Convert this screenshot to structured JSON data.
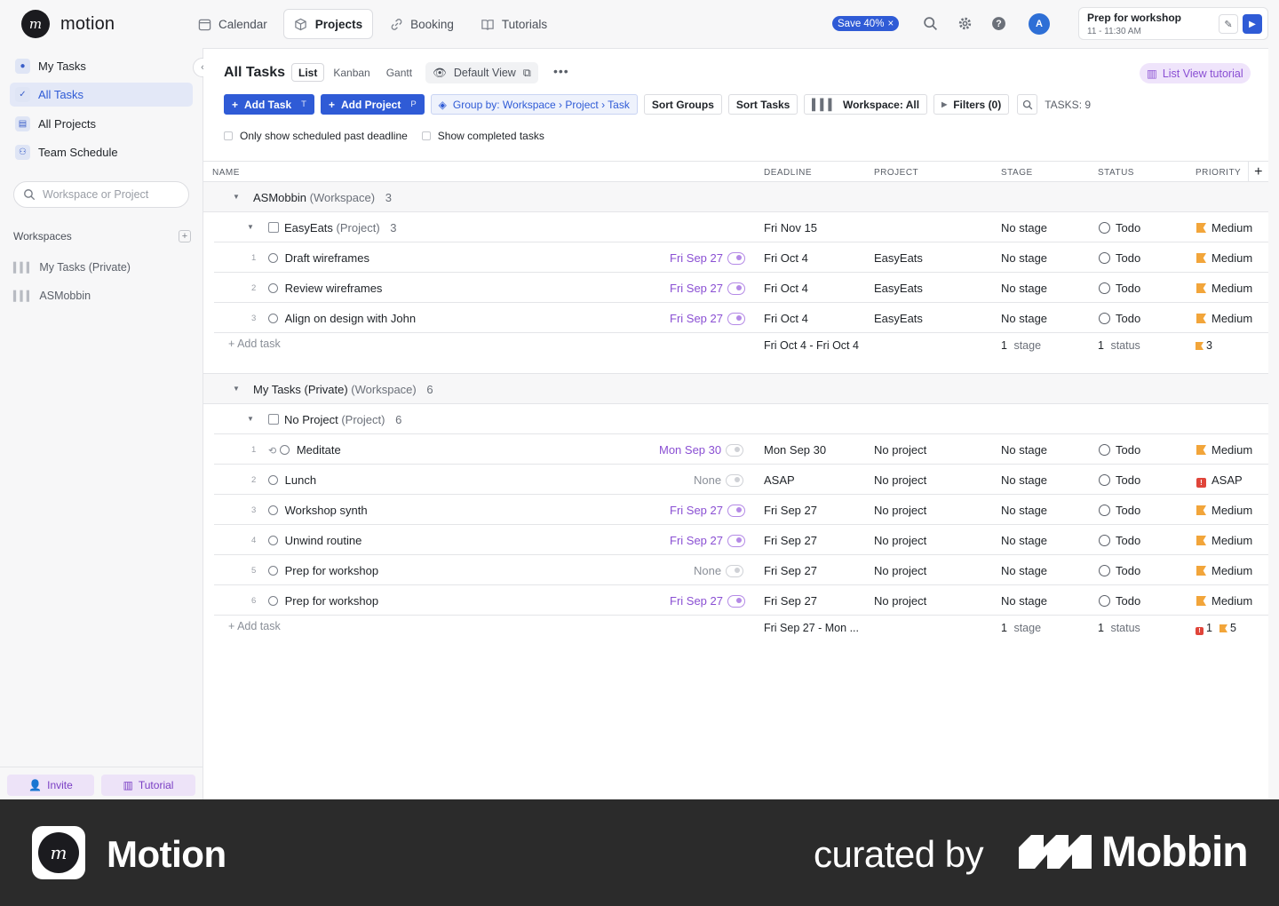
{
  "app": {
    "name": "motion"
  },
  "topnav": [
    {
      "label": "Calendar",
      "icon": "calendar-icon",
      "active": false
    },
    {
      "label": "Projects",
      "icon": "cube-icon",
      "active": true
    },
    {
      "label": "Booking",
      "icon": "link-icon",
      "active": false
    },
    {
      "label": "Tutorials",
      "icon": "book-icon",
      "active": false
    }
  ],
  "promo": {
    "label": "Save 40%",
    "close": "×"
  },
  "avatar": {
    "initial": "A"
  },
  "event": {
    "title": "Prep for workshop",
    "time": "11 - 11:30 AM"
  },
  "sidebar": {
    "items": [
      {
        "label": "My Tasks",
        "icon": "person-icon"
      },
      {
        "label": "All Tasks",
        "icon": "checkbox-icon"
      },
      {
        "label": "All Projects",
        "icon": "folder-icon"
      },
      {
        "label": "Team Schedule",
        "icon": "team-icon"
      }
    ],
    "search_placeholder": "Workspace or Project",
    "workspaces_label": "Workspaces",
    "workspaces": [
      {
        "label": "My Tasks (Private)"
      },
      {
        "label": "ASMobbin"
      }
    ],
    "invite_label": "Invite",
    "tutorial_label": "Tutorial"
  },
  "main": {
    "title": "All Tasks",
    "view_tabs": [
      "List",
      "Kanban",
      "Gantt"
    ],
    "default_view": "Default View",
    "tutorial_pill": "List View tutorial",
    "toolbar": {
      "add_task": "Add Task",
      "add_task_kbd": "T",
      "add_project": "Add Project",
      "add_project_kbd": "P",
      "group_by": "Group by: Workspace › Project › Task",
      "sort_groups": "Sort Groups",
      "sort_tasks": "Sort Tasks",
      "workspace": "Workspace: All",
      "filters": "Filters (0)",
      "tasks_count": "TASKS: 9"
    },
    "filters": {
      "past_deadline": "Only show scheduled past deadline",
      "show_completed": "Show completed tasks"
    },
    "columns": [
      "NAME",
      "DEADLINE",
      "PROJECT",
      "STAGE",
      "STATUS",
      "PRIORITY"
    ],
    "groups": [
      {
        "workspace": "ASMobbin",
        "workspace_suffix": "(Workspace)",
        "workspace_count": "3",
        "project": "EasyEats",
        "project_suffix": "(Project)",
        "project_count": "3",
        "project_deadline": "Fri Nov 15",
        "project_stage": "No stage",
        "project_status": "Todo",
        "project_priority": "Medium",
        "tasks": [
          {
            "idx": "1",
            "name": "Draft wireframes",
            "scheduled": "Fri Sep 27",
            "deadline": "Fri Oct 4",
            "project": "EasyEats",
            "stage": "No stage",
            "status": "Todo",
            "priority": "Medium"
          },
          {
            "idx": "2",
            "name": "Review wireframes",
            "scheduled": "Fri Sep 27",
            "deadline": "Fri Oct 4",
            "project": "EasyEats",
            "stage": "No stage",
            "status": "Todo",
            "priority": "Medium"
          },
          {
            "idx": "3",
            "name": "Align on design with John",
            "scheduled": "Fri Sep 27",
            "deadline": "Fri Oct 4",
            "project": "EasyEats",
            "stage": "No stage",
            "status": "Todo",
            "priority": "Medium"
          }
        ],
        "summary": {
          "add_task": "Add task",
          "deadline_range": "Fri Oct 4 - Fri Oct 4",
          "stage_count": "1",
          "stage_label": "stage",
          "status_count": "1",
          "status_label": "status",
          "priority_count": "3"
        }
      },
      {
        "workspace": "My Tasks (Private)",
        "workspace_suffix": "(Workspace)",
        "workspace_count": "6",
        "project": "No Project",
        "project_suffix": "(Project)",
        "project_count": "6",
        "tasks": [
          {
            "idx": "1",
            "name": "Meditate",
            "scheduled": "Mon Sep 30",
            "deadline": "Mon Sep 30",
            "project": "No project",
            "stage": "No stage",
            "status": "Todo",
            "priority": "Medium"
          },
          {
            "idx": "2",
            "name": "Lunch",
            "scheduled": "None",
            "deadline": "ASAP",
            "project": "No project",
            "stage": "No stage",
            "status": "Todo",
            "priority": "ASAP"
          },
          {
            "idx": "3",
            "name": "Workshop synth",
            "scheduled": "Fri Sep 27",
            "deadline": "Fri Sep 27",
            "project": "No project",
            "stage": "No stage",
            "status": "Todo",
            "priority": "Medium"
          },
          {
            "idx": "4",
            "name": "Unwind routine",
            "scheduled": "Fri Sep 27",
            "deadline": "Fri Sep 27",
            "project": "No project",
            "stage": "No stage",
            "status": "Todo",
            "priority": "Medium"
          },
          {
            "idx": "5",
            "name": "Prep for workshop",
            "scheduled": "None",
            "deadline": "Fri Sep 27",
            "project": "No project",
            "stage": "No stage",
            "status": "Todo",
            "priority": "Medium"
          },
          {
            "idx": "6",
            "name": "Prep for workshop",
            "scheduled": "Fri Sep 27",
            "deadline": "Fri Sep 27",
            "project": "No project",
            "stage": "No stage",
            "status": "Todo",
            "priority": "Medium"
          }
        ],
        "summary": {
          "add_task": "Add task",
          "deadline_range": "Fri Sep 27 - Mon ...",
          "stage_count": "1",
          "stage_label": "stage",
          "status_count": "1",
          "status_label": "status",
          "asap_count": "1",
          "priority_count": "5"
        }
      }
    ]
  },
  "branding": {
    "app_name": "Motion",
    "curated_by": "curated by",
    "mobbin": "Mobbin"
  },
  "colors": {
    "accent": "#2f5bd6",
    "purple": "#8a4fd3",
    "medium_flag": "#f2a53a",
    "asap_flag": "#e0453a"
  }
}
